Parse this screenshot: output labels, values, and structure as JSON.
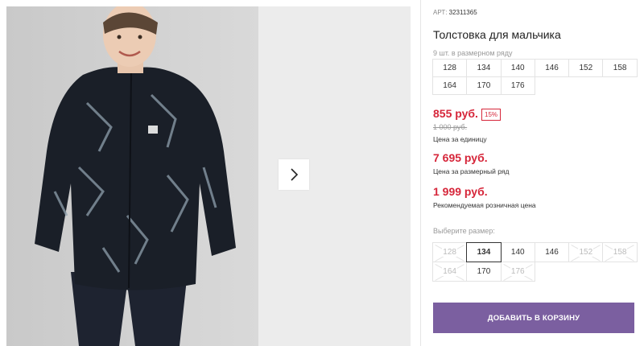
{
  "product": {
    "article_label": "АРТ:",
    "article_value": "32311365",
    "title": "Толстовка для мальчика",
    "size_row_note": "9 шт. в размерном ряду",
    "size_row": [
      "128",
      "134",
      "140",
      "146",
      "152",
      "158",
      "164",
      "170",
      "176"
    ]
  },
  "pricing": {
    "unit_price": "855 руб.",
    "discount": "15%",
    "old_price": "1 000 руб.",
    "unit_caption": "Цена за единицу",
    "row_price": "7 695 руб.",
    "row_caption": "Цена за размерный ряд",
    "retail_price": "1 999 руб.",
    "retail_caption": "Рекомендуемая розничная цена"
  },
  "size_select": {
    "label": "Выберите размер:",
    "options": [
      {
        "size": "128",
        "state": "disabled"
      },
      {
        "size": "134",
        "state": "selected"
      },
      {
        "size": "140",
        "state": "available"
      },
      {
        "size": "146",
        "state": "available"
      },
      {
        "size": "152",
        "state": "disabled"
      },
      {
        "size": "158",
        "state": "disabled"
      },
      {
        "size": "164",
        "state": "disabled"
      },
      {
        "size": "170",
        "state": "available"
      },
      {
        "size": "176",
        "state": "disabled"
      }
    ]
  },
  "actions": {
    "add_to_cart": "ДОБАВИТЬ В КОРЗИНУ"
  },
  "gallery": {
    "next_icon": "chevron-right-icon"
  },
  "colors": {
    "price_red": "#d6263a",
    "button_purple": "#7b5fa0"
  }
}
